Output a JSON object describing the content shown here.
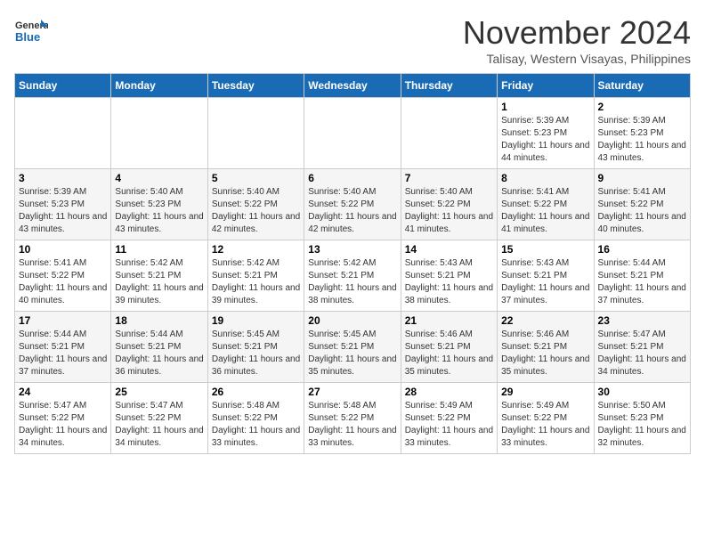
{
  "header": {
    "logo_line1": "General",
    "logo_line2": "Blue",
    "month": "November 2024",
    "location": "Talisay, Western Visayas, Philippines"
  },
  "weekdays": [
    "Sunday",
    "Monday",
    "Tuesday",
    "Wednesday",
    "Thursday",
    "Friday",
    "Saturday"
  ],
  "weeks": [
    [
      {
        "day": "",
        "info": ""
      },
      {
        "day": "",
        "info": ""
      },
      {
        "day": "",
        "info": ""
      },
      {
        "day": "",
        "info": ""
      },
      {
        "day": "",
        "info": ""
      },
      {
        "day": "1",
        "info": "Sunrise: 5:39 AM\nSunset: 5:23 PM\nDaylight: 11 hours and 44 minutes."
      },
      {
        "day": "2",
        "info": "Sunrise: 5:39 AM\nSunset: 5:23 PM\nDaylight: 11 hours and 43 minutes."
      }
    ],
    [
      {
        "day": "3",
        "info": "Sunrise: 5:39 AM\nSunset: 5:23 PM\nDaylight: 11 hours and 43 minutes."
      },
      {
        "day": "4",
        "info": "Sunrise: 5:40 AM\nSunset: 5:23 PM\nDaylight: 11 hours and 43 minutes."
      },
      {
        "day": "5",
        "info": "Sunrise: 5:40 AM\nSunset: 5:22 PM\nDaylight: 11 hours and 42 minutes."
      },
      {
        "day": "6",
        "info": "Sunrise: 5:40 AM\nSunset: 5:22 PM\nDaylight: 11 hours and 42 minutes."
      },
      {
        "day": "7",
        "info": "Sunrise: 5:40 AM\nSunset: 5:22 PM\nDaylight: 11 hours and 41 minutes."
      },
      {
        "day": "8",
        "info": "Sunrise: 5:41 AM\nSunset: 5:22 PM\nDaylight: 11 hours and 41 minutes."
      },
      {
        "day": "9",
        "info": "Sunrise: 5:41 AM\nSunset: 5:22 PM\nDaylight: 11 hours and 40 minutes."
      }
    ],
    [
      {
        "day": "10",
        "info": "Sunrise: 5:41 AM\nSunset: 5:22 PM\nDaylight: 11 hours and 40 minutes."
      },
      {
        "day": "11",
        "info": "Sunrise: 5:42 AM\nSunset: 5:21 PM\nDaylight: 11 hours and 39 minutes."
      },
      {
        "day": "12",
        "info": "Sunrise: 5:42 AM\nSunset: 5:21 PM\nDaylight: 11 hours and 39 minutes."
      },
      {
        "day": "13",
        "info": "Sunrise: 5:42 AM\nSunset: 5:21 PM\nDaylight: 11 hours and 38 minutes."
      },
      {
        "day": "14",
        "info": "Sunrise: 5:43 AM\nSunset: 5:21 PM\nDaylight: 11 hours and 38 minutes."
      },
      {
        "day": "15",
        "info": "Sunrise: 5:43 AM\nSunset: 5:21 PM\nDaylight: 11 hours and 37 minutes."
      },
      {
        "day": "16",
        "info": "Sunrise: 5:44 AM\nSunset: 5:21 PM\nDaylight: 11 hours and 37 minutes."
      }
    ],
    [
      {
        "day": "17",
        "info": "Sunrise: 5:44 AM\nSunset: 5:21 PM\nDaylight: 11 hours and 37 minutes."
      },
      {
        "day": "18",
        "info": "Sunrise: 5:44 AM\nSunset: 5:21 PM\nDaylight: 11 hours and 36 minutes."
      },
      {
        "day": "19",
        "info": "Sunrise: 5:45 AM\nSunset: 5:21 PM\nDaylight: 11 hours and 36 minutes."
      },
      {
        "day": "20",
        "info": "Sunrise: 5:45 AM\nSunset: 5:21 PM\nDaylight: 11 hours and 35 minutes."
      },
      {
        "day": "21",
        "info": "Sunrise: 5:46 AM\nSunset: 5:21 PM\nDaylight: 11 hours and 35 minutes."
      },
      {
        "day": "22",
        "info": "Sunrise: 5:46 AM\nSunset: 5:21 PM\nDaylight: 11 hours and 35 minutes."
      },
      {
        "day": "23",
        "info": "Sunrise: 5:47 AM\nSunset: 5:21 PM\nDaylight: 11 hours and 34 minutes."
      }
    ],
    [
      {
        "day": "24",
        "info": "Sunrise: 5:47 AM\nSunset: 5:22 PM\nDaylight: 11 hours and 34 minutes."
      },
      {
        "day": "25",
        "info": "Sunrise: 5:47 AM\nSunset: 5:22 PM\nDaylight: 11 hours and 34 minutes."
      },
      {
        "day": "26",
        "info": "Sunrise: 5:48 AM\nSunset: 5:22 PM\nDaylight: 11 hours and 33 minutes."
      },
      {
        "day": "27",
        "info": "Sunrise: 5:48 AM\nSunset: 5:22 PM\nDaylight: 11 hours and 33 minutes."
      },
      {
        "day": "28",
        "info": "Sunrise: 5:49 AM\nSunset: 5:22 PM\nDaylight: 11 hours and 33 minutes."
      },
      {
        "day": "29",
        "info": "Sunrise: 5:49 AM\nSunset: 5:22 PM\nDaylight: 11 hours and 33 minutes."
      },
      {
        "day": "30",
        "info": "Sunrise: 5:50 AM\nSunset: 5:23 PM\nDaylight: 11 hours and 32 minutes."
      }
    ]
  ]
}
